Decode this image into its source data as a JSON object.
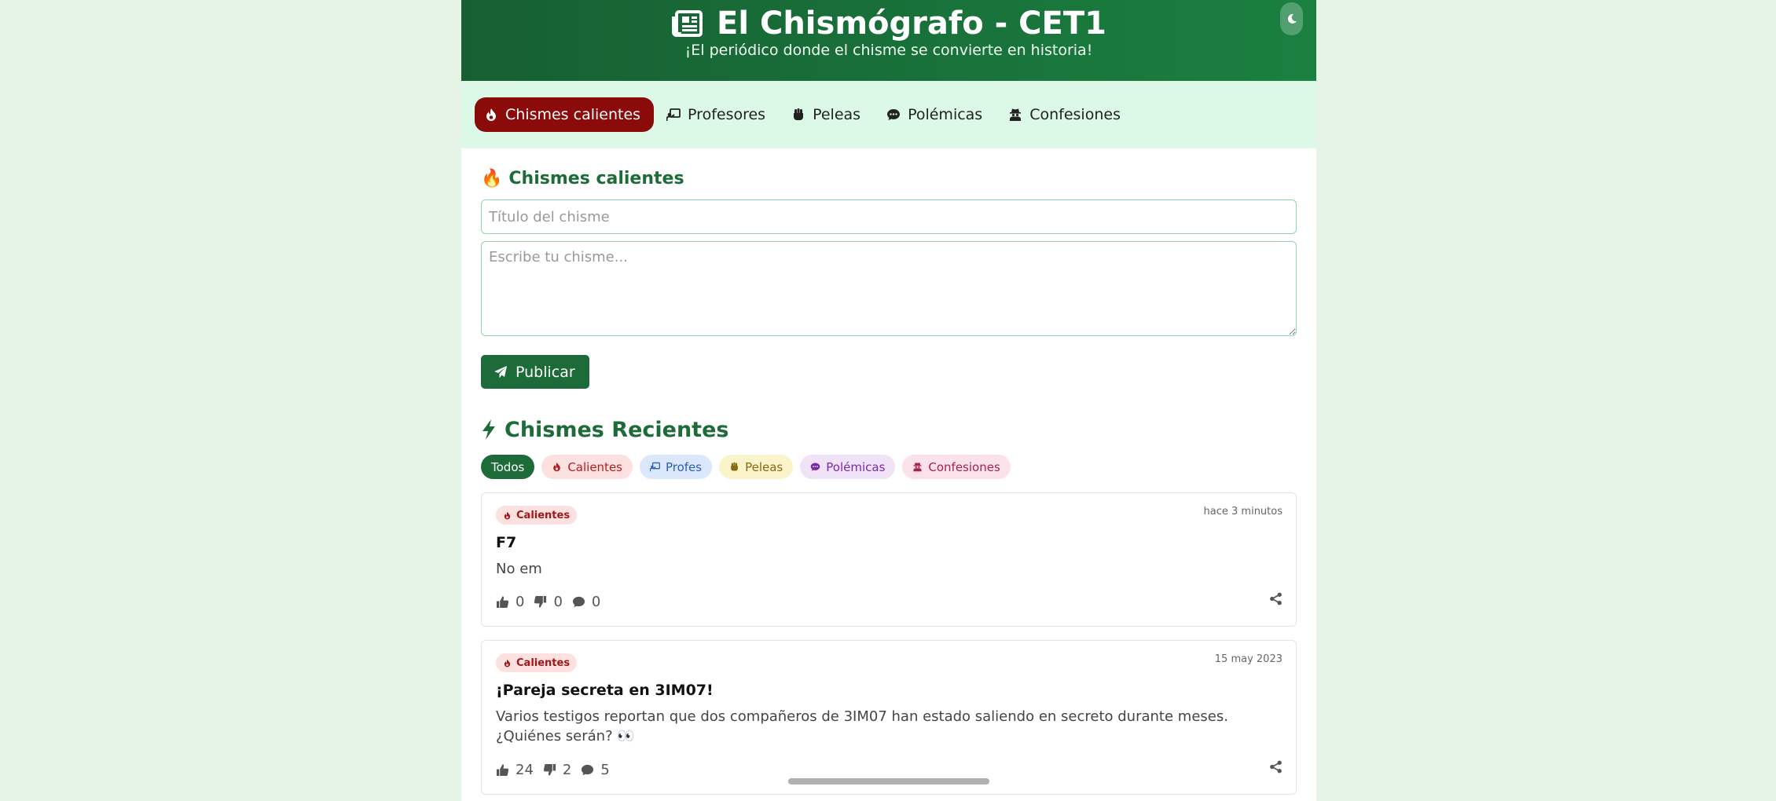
{
  "header": {
    "title": "El Chismógrafo - CET1",
    "subtitle": "¡El periódico donde el chisme se convierte en historia!",
    "theme_icon": "moon-icon"
  },
  "nav": {
    "items": [
      {
        "label": "Chismes calientes",
        "icon": "fire-icon",
        "active": true
      },
      {
        "label": "Profesores",
        "icon": "chalkboard-teacher-icon"
      },
      {
        "label": "Peleas",
        "icon": "fist-icon"
      },
      {
        "label": "Polémicas",
        "icon": "comment-dots-icon"
      },
      {
        "label": "Confesiones",
        "icon": "user-secret-icon"
      }
    ]
  },
  "form": {
    "section_emoji": "🔥",
    "section_title": "Chismes calientes",
    "title_placeholder": "Título del chisme",
    "body_placeholder": "Escribe tu chisme...",
    "publish_label": "Publicar"
  },
  "recent": {
    "title": "Chismes Recientes",
    "filters": [
      "Todos",
      "Calientes",
      "Profes",
      "Peleas",
      "Polémicas",
      "Confesiones"
    ],
    "posts": [
      {
        "category": "Calientes",
        "time": "hace 3 minutos",
        "title": "F7",
        "body": "No em",
        "likes": "0",
        "dislikes": "0",
        "comments": "0"
      },
      {
        "category": "Calientes",
        "time": "15 may 2023",
        "title": "¡Pareja secreta en 3IM07!",
        "body": "Varios testigos reportan que dos compañeros de 3IM07 han estado saliendo en secreto durante meses. ¿Quiénes serán? 👀",
        "likes": "24",
        "dislikes": "2",
        "comments": "5"
      }
    ]
  },
  "colors": {
    "primary": "#1e6b3a",
    "active_nav": "#8b0a0a",
    "nav_bg": "#dcf8e6",
    "page_bg": "#e6f4e6"
  }
}
